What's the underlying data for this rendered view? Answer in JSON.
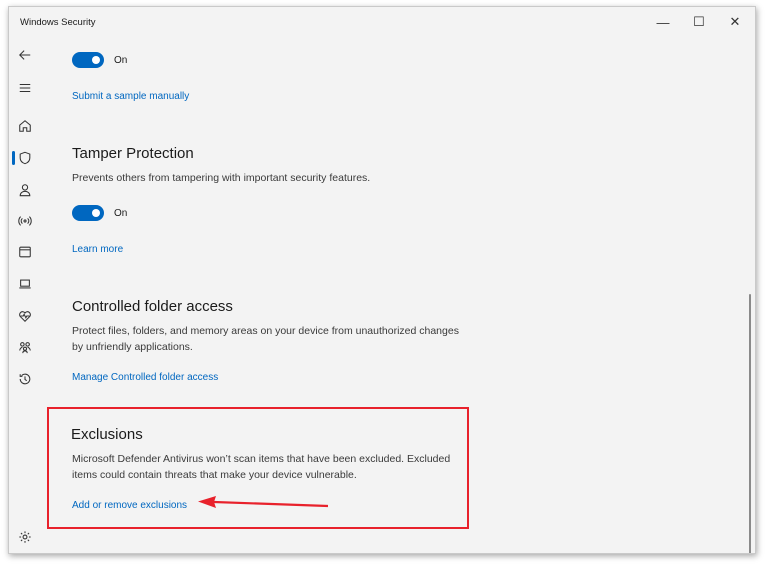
{
  "window": {
    "title": "Windows Security",
    "controls": {
      "minimize": "—",
      "maximize": "☐",
      "close": "✕"
    }
  },
  "nav": {
    "items": [
      {
        "name": "back",
        "icon": "back-arrow-icon"
      },
      {
        "name": "menu",
        "icon": "hamburger-icon"
      },
      {
        "name": "home",
        "icon": "home-icon"
      },
      {
        "name": "virus-threat-protection",
        "icon": "shield-icon",
        "active": true
      },
      {
        "name": "account-protection",
        "icon": "person-icon"
      },
      {
        "name": "firewall-network",
        "icon": "wifi-icon"
      },
      {
        "name": "app-browser-control",
        "icon": "browser-icon"
      },
      {
        "name": "device-security",
        "icon": "laptop-icon"
      },
      {
        "name": "device-performance",
        "icon": "heart-icon"
      },
      {
        "name": "family-options",
        "icon": "family-icon"
      },
      {
        "name": "protection-history",
        "icon": "history-icon"
      },
      {
        "name": "settings",
        "icon": "gear-icon"
      }
    ]
  },
  "sample_submission": {
    "toggle_label": "On",
    "link": "Submit a sample manually"
  },
  "tamper_protection": {
    "heading": "Tamper Protection",
    "description": "Prevents others from tampering with important security features.",
    "toggle_label": "On",
    "link": "Learn more"
  },
  "controlled_folder_access": {
    "heading": "Controlled folder access",
    "description": "Protect files, folders, and memory areas on your device from unauthorized changes by unfriendly applications.",
    "link": "Manage Controlled folder access"
  },
  "exclusions": {
    "heading": "Exclusions",
    "description": "Microsoft Defender Antivirus won’t scan items that have been excluded. Excluded items could contain threats that make your device vulnerable.",
    "link": "Add or remove exclusions"
  },
  "colors": {
    "accent": "#0067c0",
    "highlight": "#e8212b",
    "background": "#f3f3f3"
  }
}
